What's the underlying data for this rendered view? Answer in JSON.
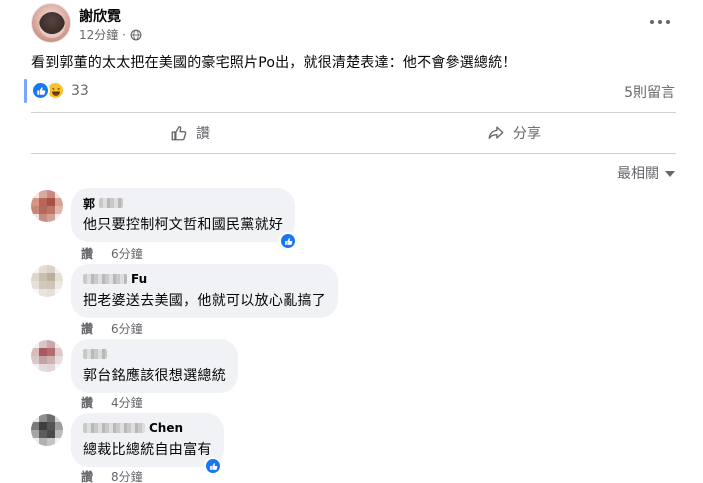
{
  "post": {
    "author": "謝欣霓",
    "time": "12分鐘",
    "separator": "·",
    "text": "看到郭董的太太把在美國的豪宅照片Po出，就很清楚表達：他不會參選總統！",
    "reaction_count": "33",
    "comment_count": "5則留言",
    "reactions": [
      "like-icon",
      "haha-icon"
    ]
  },
  "actions": {
    "like_label": "讚",
    "share_label": "分享"
  },
  "sort": {
    "label": "最相關"
  },
  "comments": [
    {
      "name_visible": "郭",
      "text": "他只要控制柯文哲和國民黨就好",
      "like_label": "讚",
      "time": "6分鐘",
      "has_like": true
    },
    {
      "name_visible": "Fu",
      "text": "把老婆送去美國，他就可以放心亂搞了",
      "like_label": "讚",
      "time": "6分鐘",
      "has_like": false
    },
    {
      "name_visible": "",
      "text": "郭台銘應該很想選總統",
      "like_label": "讚",
      "time": "4分鐘",
      "has_like": false
    },
    {
      "name_visible": "Chen",
      "text": "總裁比總統自由富有",
      "like_label": "讚",
      "time": "8分鐘",
      "has_like": true
    }
  ],
  "colors": {
    "accent": "#1877f2",
    "secondary_text": "#65676b",
    "bubble": "#f0f2f5"
  }
}
